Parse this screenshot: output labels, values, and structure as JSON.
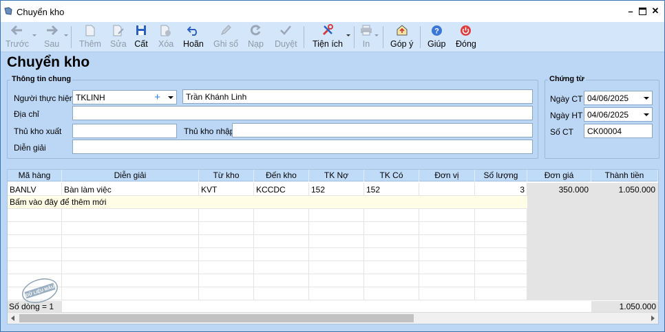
{
  "window": {
    "title": "Chuyển kho"
  },
  "toolbar": {
    "prev": "Trước",
    "next": "Sau",
    "add": "Thêm",
    "edit": "Sửa",
    "save": "Cất",
    "delete": "Xóa",
    "undo": "Hoãn",
    "post": "Ghi sổ",
    "reload": "Nạp",
    "approve": "Duyệt",
    "utilities": "Tiện ích",
    "print": "In",
    "feedback": "Góp ý",
    "help": "Giúp",
    "close": "Đóng"
  },
  "page": {
    "title": "Chuyển kho"
  },
  "general": {
    "legend": "Thông tin chung",
    "performer_label": "Người thực hiện",
    "performer_code": "TKLINH",
    "performer_name": "Trần Khánh Linh",
    "address_label": "Địa chỉ",
    "address": "",
    "out_keeper_label": "Thủ kho xuất",
    "out_keeper": "",
    "in_keeper_label": "Thủ kho nhập",
    "in_keeper": "",
    "desc_label": "Diễn giải",
    "desc": ""
  },
  "voucher": {
    "legend": "Chứng từ",
    "date_label": "Ngày CT",
    "date": "04/06/2025",
    "post_date_label": "Ngày HT",
    "post_date": "04/06/2025",
    "number_label": "Số CT",
    "number": "CK00004"
  },
  "grid": {
    "columns": [
      "Mã hàng",
      "Diễn giải",
      "Từ kho",
      "Đến kho",
      "TK Nợ",
      "TK Có",
      "Đơn vị",
      "Số lượng",
      "Đơn giá",
      "Thành tiền"
    ],
    "rows": [
      {
        "code": "BANLV",
        "desc": "Bàn làm việc",
        "from": "KVT",
        "to": "KCCDC",
        "debit": "152",
        "credit": "152",
        "unit": "",
        "qty": "3",
        "price": "350.000",
        "amount": "1.050.000"
      }
    ],
    "add_hint": "Bấm vào đây để thêm mới",
    "row_count": "Số dòng = 1",
    "total_amount": "1.050.000"
  },
  "watermark": "DỮ LIỆU MẪU",
  "colors": {
    "title_bar": "#ffffff",
    "toolbar": "#d3e6fa",
    "panel": "#bcd7f5",
    "grid_header": "#bfdbf7",
    "hint_row": "#fffde6"
  }
}
